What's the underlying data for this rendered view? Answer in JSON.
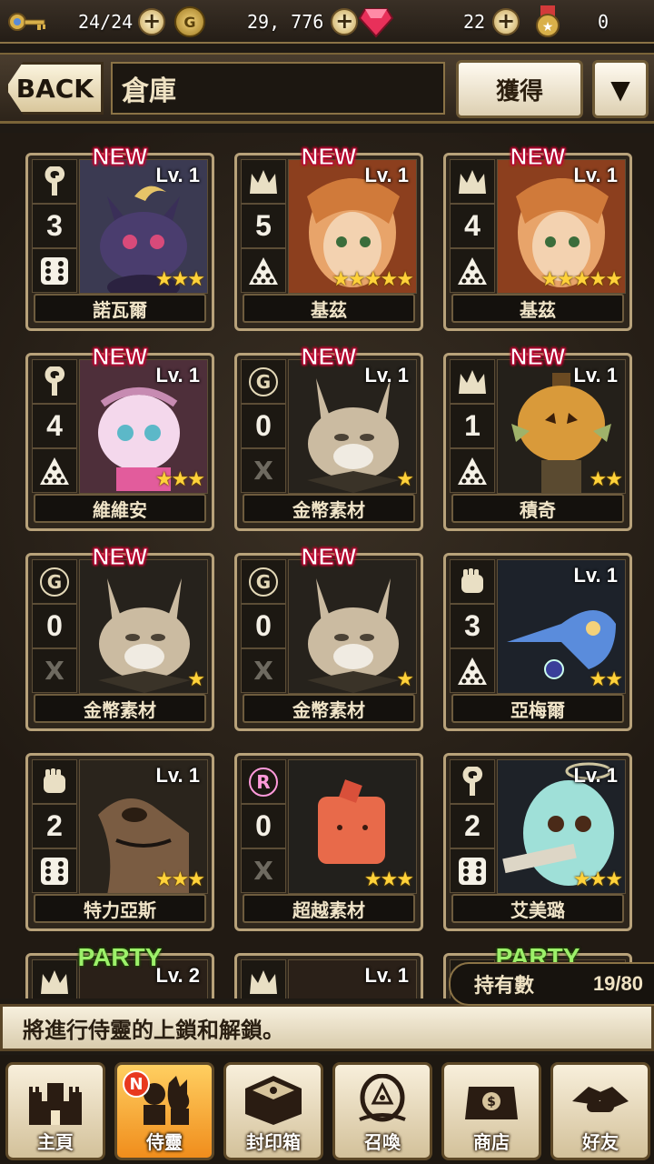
{
  "topbar": {
    "stamina": "24/24",
    "gold": "29, 776",
    "gems": "22",
    "medals": "0"
  },
  "header": {
    "back_label": "BACK",
    "title": "倉庫",
    "get_label": "獲得",
    "dropdown_glyph": "▼"
  },
  "cards": [
    {
      "name": "諾瓦爾",
      "lv": "Lv. 1",
      "tag": "NEW",
      "num": "3",
      "stars": "★★★",
      "bg": "#3b3a52",
      "art": "cat"
    },
    {
      "name": "基茲",
      "lv": "Lv. 1",
      "tag": "NEW",
      "num": "5",
      "stars": "★★★★★",
      "bg": "#7a3a1e",
      "art": "girl"
    },
    {
      "name": "基茲",
      "lv": "Lv. 1",
      "tag": "NEW",
      "num": "4",
      "stars": "★★★★★",
      "bg": "#7a3a1e",
      "art": "girl"
    },
    {
      "name": "維維安",
      "lv": "Lv. 1",
      "tag": "NEW",
      "num": "4",
      "stars": "★★★",
      "bg": "#4e2f3a",
      "art": "pink"
    },
    {
      "name": "金幣素材",
      "lv": "Lv. 1",
      "tag": "NEW",
      "num": "0",
      "stars": "★",
      "bg": "#26221c",
      "art": "fox"
    },
    {
      "name": "積奇",
      "lv": "Lv. 1",
      "tag": "NEW",
      "num": "1",
      "stars": "★★",
      "bg": "#24201a",
      "art": "pumpkin"
    },
    {
      "name": "金幣素材",
      "lv": "",
      "tag": "NEW",
      "num": "0",
      "stars": "★",
      "bg": "#26221c",
      "art": "fox"
    },
    {
      "name": "金幣素材",
      "lv": "",
      "tag": "NEW",
      "num": "0",
      "stars": "★",
      "bg": "#26221c",
      "art": "fox"
    },
    {
      "name": "亞梅爾",
      "lv": "Lv. 1",
      "tag": "",
      "num": "3",
      "stars": "★★",
      "bg": "#1d222a",
      "art": "seahorse"
    },
    {
      "name": "特力亞斯",
      "lv": "Lv. 1",
      "tag": "",
      "num": "2",
      "stars": "★★★",
      "bg": "#2a241c",
      "art": "seal"
    },
    {
      "name": "超越素材",
      "lv": "",
      "tag": "",
      "num": "0",
      "stars": "★★★",
      "bg": "#22201c",
      "art": "cube"
    },
    {
      "name": "艾美璐",
      "lv": "Lv. 1",
      "tag": "",
      "num": "2",
      "stars": "★★★",
      "bg": "#1e2228",
      "art": "ghost"
    }
  ],
  "partial_cards": [
    {
      "tag": "PARTY",
      "lv": "Lv. 2"
    },
    {
      "tag": "",
      "lv": "Lv. 1"
    },
    {
      "tag": "PARTY",
      "lv": ""
    }
  ],
  "holdings": {
    "label": "持有數",
    "value": "19/80"
  },
  "message": "將進行侍靈的上鎖和解鎖。",
  "nav": [
    {
      "label": "主頁",
      "icon": "castle-icon"
    },
    {
      "label": "侍靈",
      "icon": "spirits-icon",
      "badge": "N"
    },
    {
      "label": "封印箱",
      "icon": "seal-box-icon"
    },
    {
      "label": "召喚",
      "icon": "summon-icon"
    },
    {
      "label": "商店",
      "icon": "shop-icon"
    },
    {
      "label": "好友",
      "icon": "friends-icon"
    }
  ]
}
